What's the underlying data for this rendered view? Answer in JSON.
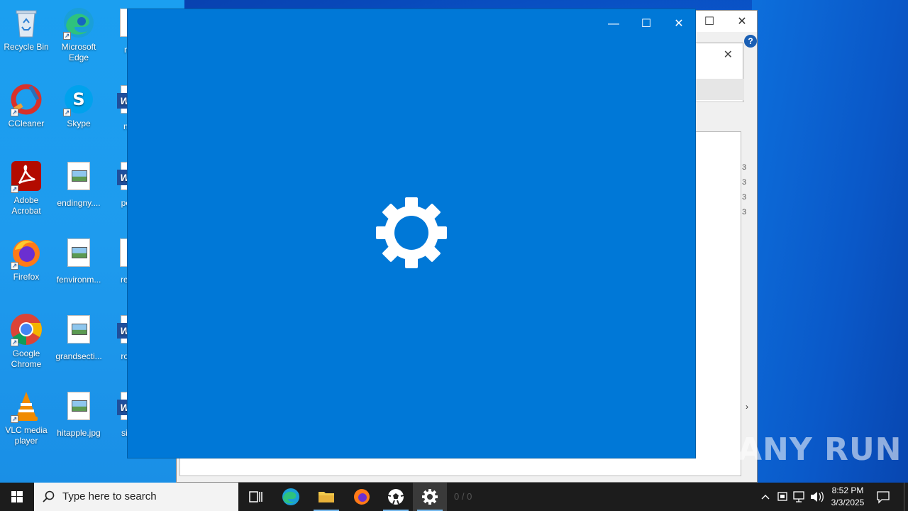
{
  "desktop": {
    "icons": [
      {
        "label": "Recycle Bin",
        "icon": "recycle-bin-icon"
      },
      {
        "label": "Microsoft Edge",
        "icon": "edge-icon"
      },
      {
        "label": "msr",
        "icon": "document-icon"
      },
      {
        "label": "CCleaner",
        "icon": "ccleaner-icon"
      },
      {
        "label": "Skype",
        "icon": "skype-icon"
      },
      {
        "label": "novi",
        "icon": "word-doc-icon"
      },
      {
        "label": "Adobe Acrobat",
        "icon": "acrobat-icon"
      },
      {
        "label": "endingny....",
        "icon": "image-file-icon"
      },
      {
        "label": "powe",
        "icon": "word-doc-icon"
      },
      {
        "label": "Firefox",
        "icon": "firefox-icon"
      },
      {
        "label": "fenvironm...",
        "icon": "image-file-icon"
      },
      {
        "label": "resea",
        "icon": "document-icon"
      },
      {
        "label": "Google Chrome",
        "icon": "chrome-icon"
      },
      {
        "label": "grandsecti...",
        "icon": "image-file-icon"
      },
      {
        "label": "rocke",
        "icon": "word-doc-icon"
      },
      {
        "label": "VLC media player",
        "icon": "vlc-icon"
      },
      {
        "label": "hitapple.jpg",
        "icon": "image-file-icon"
      },
      {
        "label": "sidec",
        "icon": "word-doc-icon"
      }
    ]
  },
  "splash_window": {
    "background": "#0078d7",
    "controls": {
      "minimize": "—",
      "maximize": "☐",
      "close": "✕"
    },
    "center_icon": "settings-gear-icon"
  },
  "background_window": {
    "help": "?",
    "row_marks": [
      "3",
      "3",
      "3",
      "3"
    ]
  },
  "taskbar": {
    "search_placeholder": "Type here to search",
    "ghost_text": "0 / 0",
    "clock_time": "8:52 PM",
    "clock_date": "3/3/2025"
  },
  "watermark": "ANY RUN"
}
